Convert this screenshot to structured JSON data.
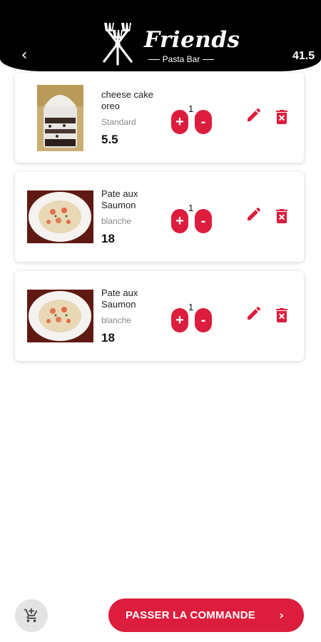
{
  "header": {
    "back_icon": "chevron-left-icon",
    "brand_title": "Friends",
    "brand_subtitle": "Pasta Bar",
    "total": "41.5"
  },
  "cart_items": [
    {
      "name": "cheese cake oreo",
      "option": "Standard",
      "price": "5.5",
      "quantity": "1",
      "image": "cheesecake-cup"
    },
    {
      "name": "Pate aux Saumon",
      "option": "blanche",
      "price": "18",
      "quantity": "1",
      "image": "salmon-pasta-plate"
    },
    {
      "name": "Pate aux Saumon",
      "option": "blanche",
      "price": "18",
      "quantity": "1",
      "image": "salmon-pasta-plate"
    }
  ],
  "controls": {
    "plus_label": "+",
    "minus_label": "-",
    "edit_icon": "pencil-icon",
    "delete_icon": "trash-icon"
  },
  "footer": {
    "cart_icon": "cart-add-icon",
    "order_label": "PASSER LA COMMANDE",
    "order_chevron": "›"
  },
  "colors": {
    "accent": "#dc1d3d",
    "header_bg": "#000000",
    "cart_fab_bg": "#e3e3e3"
  }
}
